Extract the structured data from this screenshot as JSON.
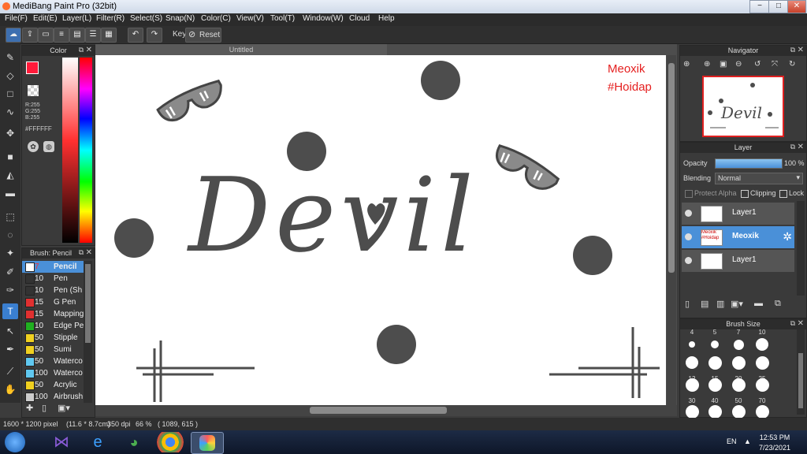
{
  "window": {
    "title": "MediBang Paint Pro (32bit)",
    "min": "−",
    "max": "□",
    "close": "✕"
  },
  "menu": [
    "File(F)",
    "Edit(E)",
    "Layer(L)",
    "Filter(R)",
    "Select(S)",
    "Snap(N)",
    "Color(C)",
    "View(V)",
    "Tool(T)",
    "Window(W)",
    "Cloud",
    "Help"
  ],
  "toolbar": {
    "key_label": "Key",
    "reset_label": "Reset"
  },
  "document": {
    "tab_title": "Untitled",
    "watermark_line1": "Meoxik",
    "watermark_line2": "#Hoidap",
    "artwork_text": "Devil"
  },
  "color_panel": {
    "title": "Color",
    "r": "R:255",
    "g": "G:255",
    "b": "B:255",
    "hex": "#FFFFFF"
  },
  "brush_panel": {
    "title": "Brush: Pencil",
    "items": [
      {
        "size": "7",
        "name": "Pencil",
        "color": "#ffffff",
        "selected": true
      },
      {
        "size": "10",
        "name": "Pen",
        "color": "#333333"
      },
      {
        "size": "10",
        "name": "Pen (Sh",
        "color": "#333333"
      },
      {
        "size": "15",
        "name": "G Pen",
        "color": "#e03030"
      },
      {
        "size": "15",
        "name": "Mapping",
        "color": "#e03030"
      },
      {
        "size": "10",
        "name": "Edge Pe",
        "color": "#20b020"
      },
      {
        "size": "50",
        "name": "Stipple",
        "color": "#f0d020"
      },
      {
        "size": "50",
        "name": "Sumi",
        "color": "#f0d020"
      },
      {
        "size": "50",
        "name": "Waterco",
        "color": "#60c8f0"
      },
      {
        "size": "100",
        "name": "Waterco",
        "color": "#60c8f0"
      },
      {
        "size": "50",
        "name": "Acrylic",
        "color": "#f0d020"
      },
      {
        "size": "100",
        "name": "Airbrush",
        "color": "#cccccc"
      }
    ]
  },
  "navigator": {
    "title": "Navigator"
  },
  "layer_panel": {
    "title": "Layer",
    "opacity_label": "Opacity",
    "opacity_value": "100 %",
    "opacity_fraction": 1.0,
    "blending_label": "Blending",
    "blending_value": "Normal",
    "protect_alpha": "Protect Alpha",
    "clipping": "Clipping",
    "lock": "Lock",
    "layers": [
      {
        "name": "Layer1",
        "selected": false
      },
      {
        "name": "Meoxik",
        "selected": true,
        "thumb": "Meoxik #Hoidap"
      },
      {
        "name": "Layer1",
        "selected": false
      }
    ]
  },
  "brush_size_panel": {
    "title": "Brush Size",
    "row_labels": [
      [
        "4",
        "5",
        "7",
        "10"
      ],
      [
        "12",
        "15",
        "20",
        "25"
      ],
      [
        "30",
        "40",
        "50",
        "70"
      ]
    ]
  },
  "status": {
    "dimensions": "1600 * 1200 pixel",
    "physical": "(11.6 * 8.7cm)",
    "dpi": "350 dpi",
    "zoom": "66 %",
    "coords": "( 1089, 615 )"
  },
  "taskbar": {
    "lang": "EN",
    "time": "12:53 PM",
    "date": "7/23/2021"
  }
}
